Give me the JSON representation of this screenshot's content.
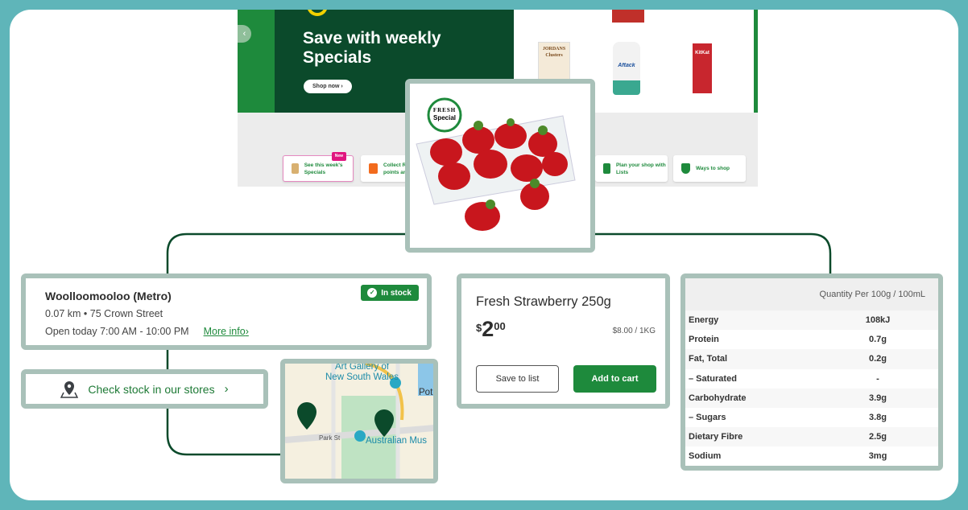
{
  "banner": {
    "title": "Save with weekly Specials",
    "shop_now": "Shop now ›",
    "prev": "‹",
    "tiles": [
      {
        "label": "See this week's Specials",
        "badge": "New"
      },
      {
        "label": "Collect R points an"
      },
      {
        "label": "Plan your shop with Lists"
      },
      {
        "label": "Ways to shop"
      }
    ],
    "products": [
      "JORDANS Clusters",
      "Aftack",
      "KitKat"
    ]
  },
  "product_image": {
    "badge_line1": "FRESH",
    "badge_line2": "Special"
  },
  "store": {
    "name": "Woolloomooloo (Metro)",
    "distance_address": "0.07 km • 75 Crown Street",
    "hours": "Open today 7:00 AM - 10:00 PM",
    "more_info": "More info",
    "stock_status": "In stock"
  },
  "check_stock": {
    "label": "Check stock in our stores",
    "chevron": "›"
  },
  "map": {
    "labels": [
      "Art Gallery of",
      "New South Wales",
      "Park St",
      "Australian Mus",
      "Pot"
    ]
  },
  "product": {
    "title": "Fresh Strawberry 250g",
    "price_dollars": "2",
    "price_cents": "00",
    "currency": "$",
    "unit_price": "$8.00 / 1KG",
    "save_to_list": "Save to list",
    "add_to_cart": "Add to cart"
  },
  "nutrition": {
    "header": "Quantity Per 100g / 100mL",
    "rows": [
      {
        "name": "Energy",
        "value": "108kJ"
      },
      {
        "name": "Protein",
        "value": "0.7g"
      },
      {
        "name": "Fat, Total",
        "value": "0.2g"
      },
      {
        "name": "– Saturated",
        "value": "-"
      },
      {
        "name": "Carbohydrate",
        "value": "3.9g"
      },
      {
        "name": "– Sugars",
        "value": "3.8g"
      },
      {
        "name": "Dietary Fibre",
        "value": "2.5g"
      },
      {
        "name": "Sodium",
        "value": "3mg"
      }
    ]
  },
  "colors": {
    "background": "#5fb5b9",
    "brand_green": "#1e8a3c",
    "dark_green": "#0b4a2b",
    "frame": "#a9c1b9"
  }
}
